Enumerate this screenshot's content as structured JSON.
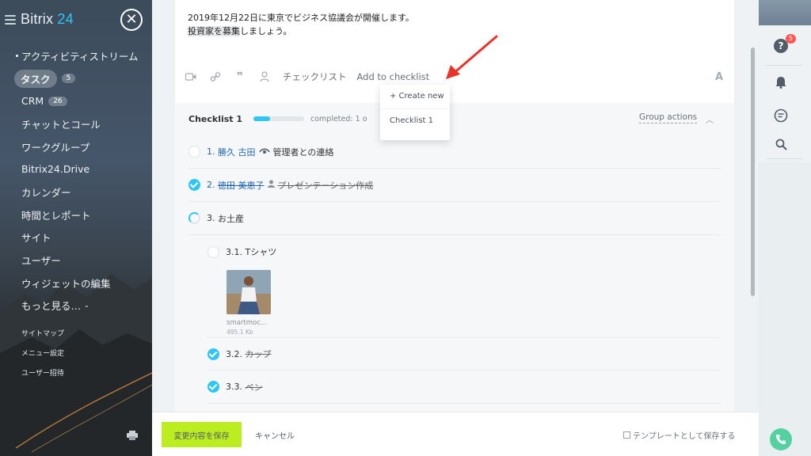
{
  "sidebar": {
    "logo_text": "Bitrix",
    "logo_num": "24",
    "close_glyph": "✕",
    "items": [
      {
        "label": "アクティビティストリーム"
      },
      {
        "label": "タスク",
        "badge": "5"
      },
      {
        "label": "CRM",
        "badge": "26"
      },
      {
        "label": "チャットとコール"
      },
      {
        "label": "ワークグループ"
      },
      {
        "label": "Bitrix24.Drive"
      },
      {
        "label": "カレンダー"
      },
      {
        "label": "時間とレポート"
      },
      {
        "label": "サイト"
      },
      {
        "label": "ユーザー"
      },
      {
        "label": "ウィジェットの編集"
      },
      {
        "label": "もっと見る…"
      }
    ],
    "small_items": [
      "サイトマップ",
      "メニュー設定",
      "ユーザー招待"
    ]
  },
  "description": {
    "line1": "2019年12月22日に東京でビジネス協議会が開催します。",
    "line2_hl": "投資家を募集",
    "line2_rest": "しましょう。"
  },
  "toolbar": {
    "checklist_label": "チェックリスト",
    "add_to_checklist_label": "Add to checklist",
    "font_label": "A"
  },
  "dropdown": {
    "create_new": "+ Create new",
    "checklist1": "Checklist 1"
  },
  "checklist": {
    "title": "Checklist 1",
    "progress": 0.33,
    "completed_label": "completed: 1 o",
    "group_actions": "Group actions",
    "items": [
      {
        "num": "1.",
        "person": "勝久 古田",
        "text": "管理者との連絡",
        "state": "empty"
      },
      {
        "num": "2.",
        "person": "徳田 美恵子",
        "text": "プレゼンテーション作成",
        "state": "done"
      },
      {
        "num": "3.",
        "text": "お土産",
        "state": "partial"
      },
      {
        "num": "3.1.",
        "text": "Tシャツ",
        "state": "empty"
      },
      {
        "num": "3.2.",
        "text": "カップ",
        "state": "done"
      },
      {
        "num": "3.3.",
        "text": "ペン",
        "state": "done"
      }
    ],
    "attachment": {
      "name": "smartmoc…",
      "size": "495.1 Kb"
    }
  },
  "footer": {
    "save_label": "変更内容を保存",
    "cancel_label": "キャンセル",
    "template_label": "テンプレートとして保存する"
  },
  "right_panel": {
    "notify_badge": "5"
  },
  "colors": {
    "accent": "#2fc6f6",
    "save_button": "#bbed21",
    "arrow": "#e8332a",
    "phone": "#55d0a0"
  }
}
